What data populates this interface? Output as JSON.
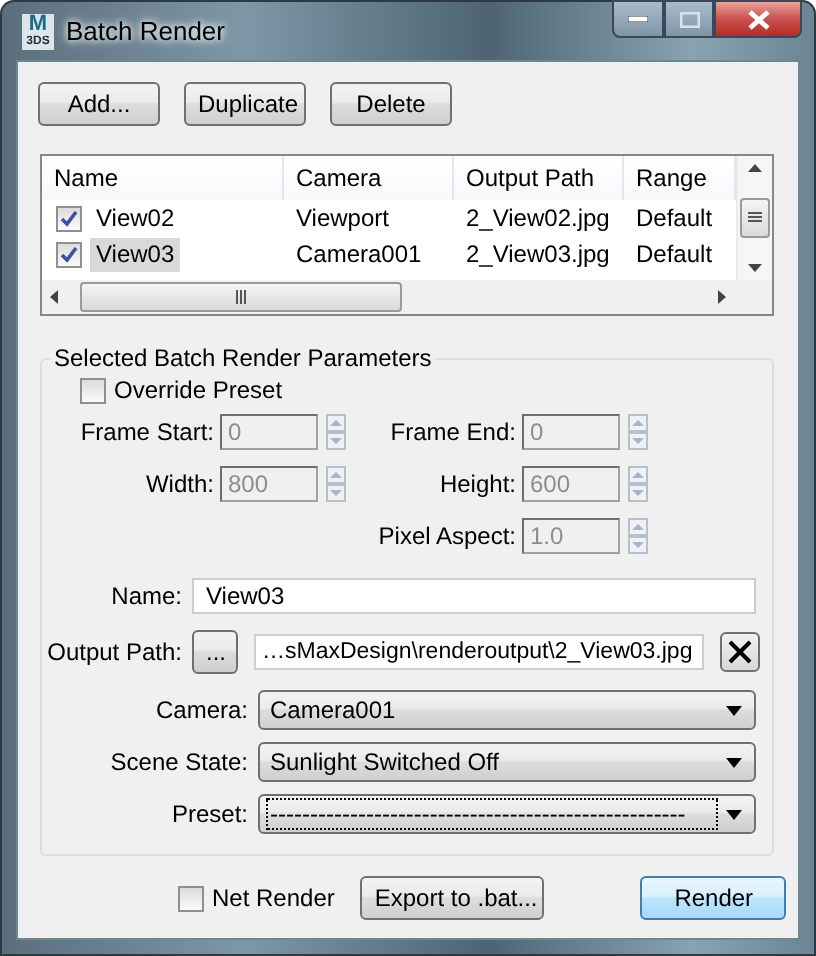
{
  "window": {
    "title": "Batch Render",
    "icon": {
      "mark": "M",
      "sub": "3DS"
    }
  },
  "toolbar": [
    {
      "label": "Add..."
    },
    {
      "label": "Duplicate"
    },
    {
      "label": "Delete"
    }
  ],
  "list": {
    "columns": [
      "Name",
      "Camera",
      "Output Path",
      "Range"
    ],
    "rows": [
      {
        "checked": true,
        "selected": false,
        "cells": [
          "View02",
          "Viewport",
          "2_View02.jpg",
          "Default"
        ]
      },
      {
        "checked": true,
        "selected": true,
        "cells": [
          "View03",
          "Camera001",
          "2_View03.jpg",
          "Default"
        ]
      }
    ]
  },
  "group": {
    "title": "Selected Batch Render Parameters",
    "override": {
      "label": "Override Preset",
      "checked": false
    },
    "spinners": [
      {
        "label": "Frame Start:",
        "value": "0",
        "disabled": true
      },
      {
        "label": "Frame End:",
        "value": "0",
        "disabled": true
      },
      {
        "label": "Width:",
        "value": "800",
        "disabled": true
      },
      {
        "label": "Height:",
        "value": "600",
        "disabled": true
      },
      {
        "label": "Pixel Aspect:",
        "value": "1.0",
        "disabled": true
      }
    ],
    "name": {
      "label": "Name:",
      "value": "View03"
    },
    "output_path": {
      "label": "Output Path:",
      "browse": "...",
      "value": "…sMaxDesign\\renderoutput\\2_View03.jpg"
    },
    "dropdowns": [
      {
        "label": "Camera:",
        "value": "Camera001",
        "focused": false
      },
      {
        "label": "Scene State:",
        "value": "Sunlight Switched Off",
        "focused": false
      },
      {
        "label": "Preset:",
        "value": "----------------------------------------------------",
        "focused": true
      }
    ]
  },
  "footer": {
    "net_render": {
      "label": "Net Render",
      "checked": false
    },
    "export": "Export to .bat...",
    "render": "Render"
  }
}
